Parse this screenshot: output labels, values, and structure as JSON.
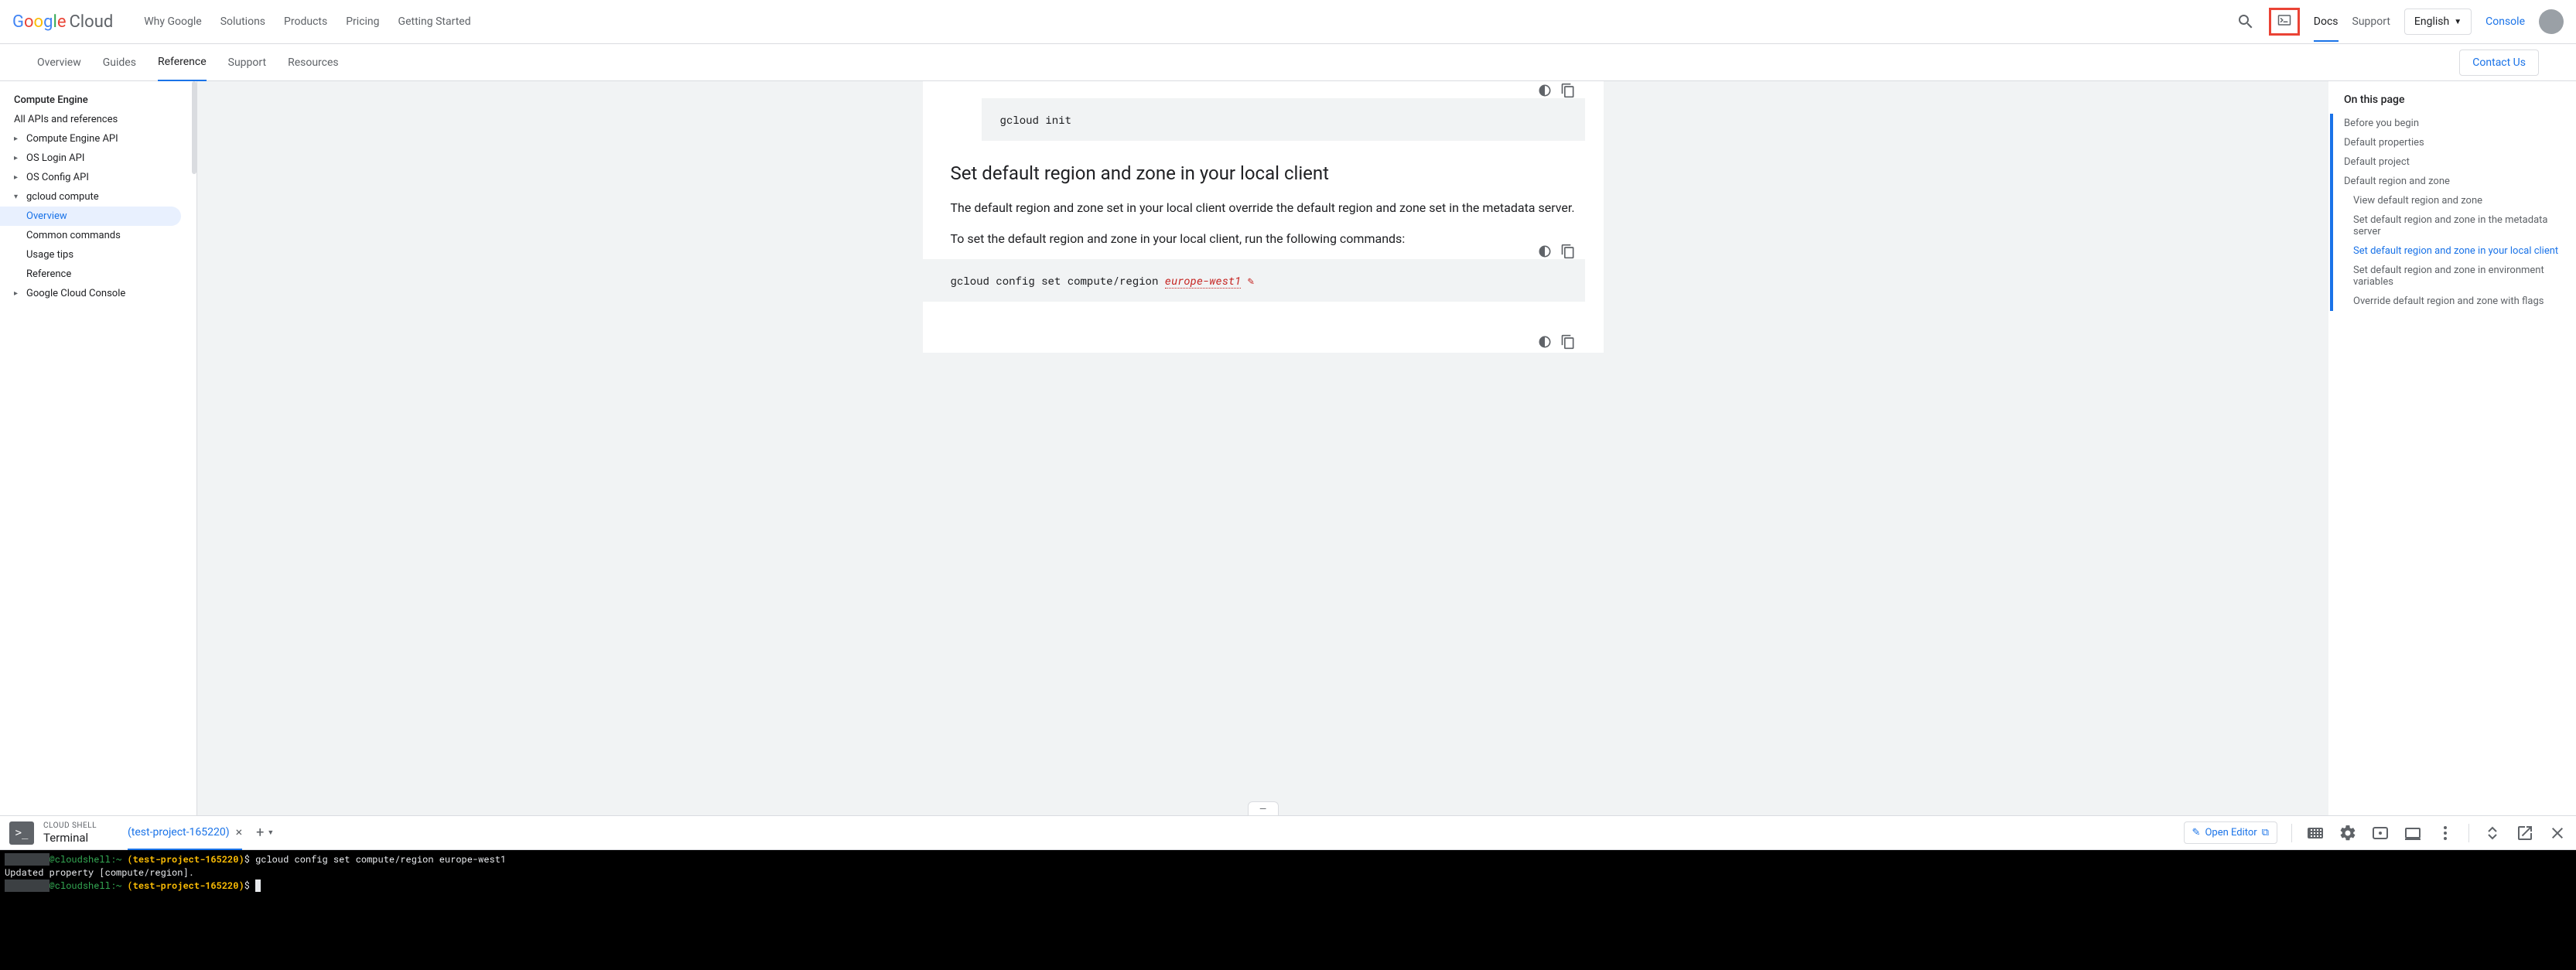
{
  "header": {
    "logo_text_cloud": "Cloud",
    "nav": [
      "Why Google",
      "Solutions",
      "Products",
      "Pricing",
      "Getting Started"
    ],
    "docs": "Docs",
    "support": "Support",
    "language": "English",
    "console": "Console"
  },
  "subnav": {
    "items": [
      "Overview",
      "Guides",
      "Reference",
      "Support",
      "Resources"
    ],
    "active_index": 2,
    "contact": "Contact Us"
  },
  "sidebar": {
    "items": [
      {
        "label": "Compute Engine",
        "bold": true
      },
      {
        "label": "All APIs and references"
      },
      {
        "label": "Compute Engine API",
        "caret": "▸"
      },
      {
        "label": "OS Login API",
        "caret": "▸"
      },
      {
        "label": "OS Config API",
        "caret": "▸"
      },
      {
        "label": "gcloud compute",
        "caret": "▾"
      },
      {
        "label": "Overview",
        "nested": true,
        "active": true
      },
      {
        "label": "Common commands",
        "nested": true
      },
      {
        "label": "Usage tips",
        "nested": true
      },
      {
        "label": "Reference",
        "nested": true
      },
      {
        "label": "Google Cloud Console",
        "caret": "▸"
      }
    ]
  },
  "content": {
    "code1": "gcloud init",
    "heading": "Set default region and zone in your local client",
    "para1": "The default region and zone set in your local client override the default region and zone set in the metadata server.",
    "para2": "To set the default region and zone in your local client, run the following commands:",
    "code2_prefix": "gcloud config set compute/region ",
    "code2_param": "europe-west1"
  },
  "toc": {
    "title": "On this page",
    "items": [
      {
        "label": "Before you begin"
      },
      {
        "label": "Default properties"
      },
      {
        "label": "Default project"
      },
      {
        "label": "Default region and zone"
      },
      {
        "label": "View default region and zone",
        "sub": true
      },
      {
        "label": "Set default region and zone in the metadata server",
        "sub": true
      },
      {
        "label": "Set default region and zone in your local client",
        "sub": true,
        "active": true
      },
      {
        "label": "Set default region and zone in environment variables",
        "sub": true
      },
      {
        "label": "Override default region and zone with flags",
        "sub": true
      }
    ]
  },
  "cloudshell": {
    "overline": "CLOUD SHELL",
    "title": "Terminal",
    "tab": "(test-project-165220)",
    "open_editor": "Open Editor",
    "terminal": {
      "user_host": "@cloudshell:",
      "tilde": "~ ",
      "project": "(test-project-165220)",
      "prompt": "$ ",
      "cmd1": "gcloud config set compute/region europe-west1",
      "output1": "Updated property [compute/region]."
    }
  }
}
